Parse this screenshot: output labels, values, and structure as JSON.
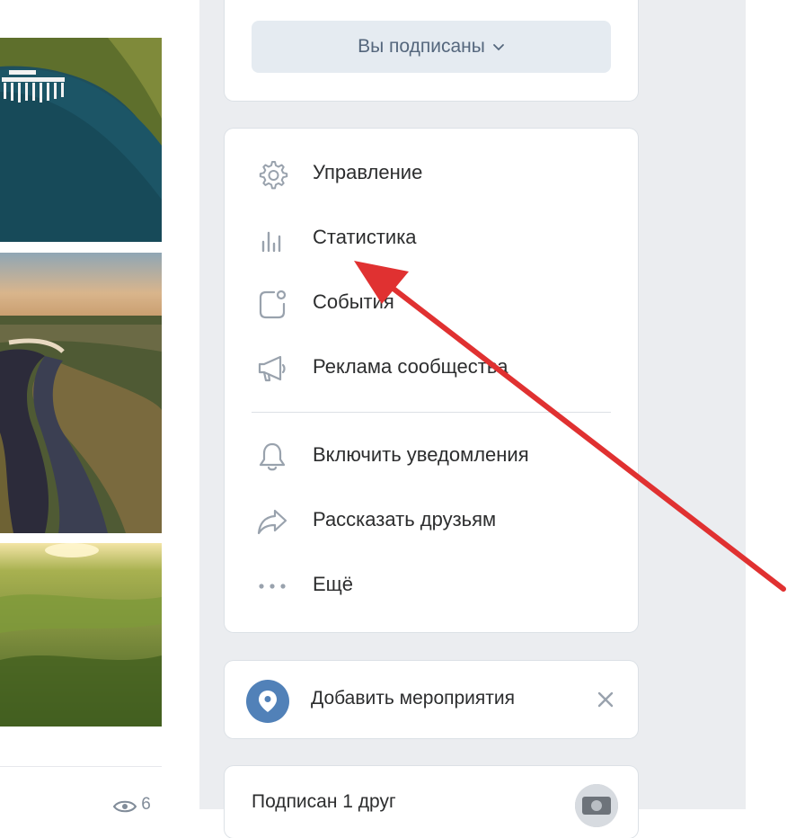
{
  "subscription": {
    "button_label": "Вы подписаны"
  },
  "menu": {
    "items": [
      {
        "label": "Управление",
        "icon": "gear-icon"
      },
      {
        "label": "Статистика",
        "icon": "stats-icon"
      },
      {
        "label": "События",
        "icon": "events-icon"
      },
      {
        "label": "Реклама сообщества",
        "icon": "megaphone-icon"
      },
      {
        "label": "Включить уведомления",
        "icon": "bell-icon"
      },
      {
        "label": "Рассказать друзьям",
        "icon": "share-icon"
      },
      {
        "label": "Ещё",
        "icon": "more-icon"
      }
    ]
  },
  "event_card": {
    "label": "Добавить мероприятия",
    "icon": "location-pin-icon"
  },
  "friends_card": {
    "label": "Подписан 1 друг"
  },
  "feed": {
    "views_count": "6"
  },
  "colors": {
    "accent": "#5181b8",
    "annotation_arrow": "#e03131",
    "column_bg": "#ebedf0"
  }
}
